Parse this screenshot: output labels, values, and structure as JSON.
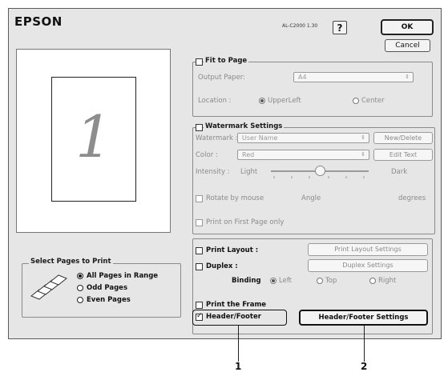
{
  "brand": "EPSON",
  "version": "AL-C2000 1.30",
  "help_label": "?",
  "ok_label": "OK",
  "cancel_label": "Cancel",
  "preview": {
    "page_number": "1"
  },
  "fit_to_page": {
    "label": "Fit to Page",
    "checked": false,
    "output_paper_label": "Output Paper:",
    "output_paper_value": "A4",
    "location_label": "Location :",
    "location_options": [
      "UpperLeft",
      "Center"
    ],
    "location_selected": "UpperLeft"
  },
  "watermark": {
    "label": "Watermark Settings",
    "checked": false,
    "watermark_label": "Watermark :",
    "watermark_value": "User Name",
    "new_delete_label": "New/Delete",
    "color_label": "Color :",
    "color_value": "Red",
    "edit_text_label": "Edit Text",
    "intensity_label": "Intensity :",
    "intensity_light": "Light",
    "intensity_dark": "Dark",
    "intensity_level": 0.5,
    "rotate_label": "Rotate by mouse",
    "angle_label": "Angle",
    "degrees_label": "degrees",
    "first_page_label": "Print on First Page only"
  },
  "select_pages": {
    "title": "Select Pages to Print",
    "options": [
      "All Pages in Range",
      "Odd Pages",
      "Even Pages"
    ],
    "selected": "All Pages in Range"
  },
  "layout": {
    "print_layout_label": "Print Layout :",
    "print_layout_settings_label": "Print Layout Settings",
    "duplex_label": "Duplex :",
    "duplex_settings_label": "Duplex Settings",
    "binding_label": "Binding",
    "binding_options": [
      "Left",
      "Top",
      "Right"
    ],
    "binding_selected": "Left",
    "print_frame_label": "Print the Frame",
    "header_footer_label": "Header/Footer",
    "header_footer_checked": true,
    "header_footer_settings_label": "Header/Footer Settings"
  },
  "callouts": [
    "1",
    "2"
  ]
}
